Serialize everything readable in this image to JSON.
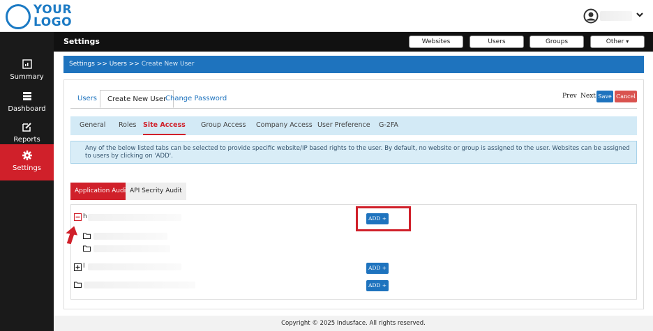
{
  "logo": {
    "text_line1": "YOUR",
    "text_line2": "LOGO"
  },
  "sidebar": {
    "items": [
      {
        "label": "Summary",
        "icon": "summary-icon"
      },
      {
        "label": "Dashboard",
        "icon": "dashboard-icon"
      },
      {
        "label": "Reports",
        "icon": "reports-icon"
      },
      {
        "label": "Settings",
        "icon": "gear-icon"
      }
    ]
  },
  "header": {
    "title": "Settings",
    "buttons": {
      "websites": "Websites",
      "users": "Users",
      "groups": "Groups",
      "other": "Other"
    }
  },
  "breadcrumb": {
    "part1": "Settings >> Users >> ",
    "current": "Create New User"
  },
  "tabs": {
    "users": "Users",
    "create_new_user": "Create New User",
    "change_password": "Change Password"
  },
  "actions": {
    "prev": "Prev",
    "next": "Next",
    "save": "Save",
    "cancel": "Cancel"
  },
  "subtabs": {
    "general": "General",
    "roles": "Roles",
    "site_access": "Site Access",
    "group_access": "Group Access",
    "company_access": "Company Access",
    "user_preference": "User Preference",
    "g2fa": "G-2FA"
  },
  "info_text": "Any of the below listed tabs can be selected to provide specific website/IP based rights to the user. By default, no website or group is assigned to the user. Websites can be assigned to users by clicking on 'ADD'.",
  "audit_tabs": {
    "application": "Application Audit",
    "api": "API Secrity Audit"
  },
  "tree": {
    "node1_label": "h",
    "node2_label": "l",
    "add_label": "ADD +"
  },
  "footer": {
    "text": "Copyright © 2025 Indusface. All rights reserved."
  },
  "colors": {
    "primary": "#1e73be",
    "danger": "#d0202a",
    "sidebar": "#1a1a1a"
  }
}
